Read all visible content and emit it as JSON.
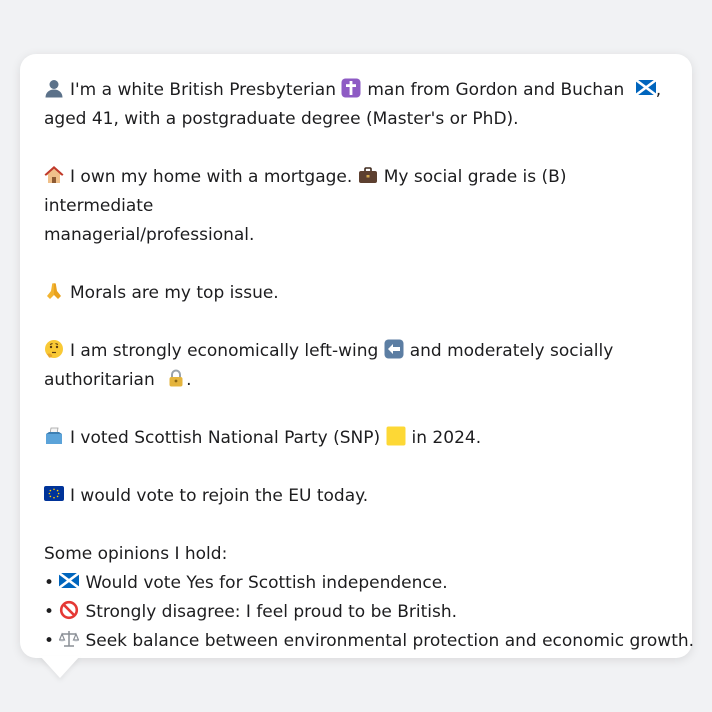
{
  "persona": {
    "intro_1": "I'm a white British Presbyterian",
    "intro_2": "man from Gordon and Buchan",
    "intro_3": ",",
    "intro_4": "aged 41, with a postgraduate degree (Master's or PhD).",
    "home_1": "I own my home with a mortgage.",
    "home_2": "My social grade is (B) intermediate",
    "home_3": "managerial/professional.",
    "issue": "Morals are my top issue.",
    "politics_1": "I am strongly economically left-wing",
    "politics_2": "and moderately socially",
    "politics_3": "authoritarian",
    "politics_4": ".",
    "vote_1": "I voted Scottish National Party (SNP)",
    "vote_2": "in 2024.",
    "eu": "I would vote to rejoin the EU today.",
    "opinions_header": "Some opinions I hold:",
    "bullet": "•",
    "opinions": [
      "Would vote Yes for Scottish independence.",
      "Strongly disagree: I feel proud to be British.",
      "Seek balance between environmental protection and economic growth."
    ]
  },
  "icons": {
    "person": "person-silhouette-icon",
    "cross": "latin-cross-icon",
    "scotland_flag": "scotland-flag-icon",
    "house": "house-icon",
    "briefcase": "briefcase-icon",
    "pray": "folded-hands-icon",
    "thinking": "thinking-face-icon",
    "left_arrow": "left-arrow-icon",
    "lock": "lock-icon",
    "ballot": "ballot-box-icon",
    "snp_square": "yellow-square-icon",
    "eu_flag": "eu-flag-icon",
    "prohibited": "prohibited-icon",
    "scales": "balance-scale-icon"
  },
  "colors": {
    "background": "#f1f2f4",
    "bubble": "#ffffff",
    "text": "#1d1d1f",
    "snp_yellow": "#fdd835",
    "saltire_blue": "#0065bd",
    "eu_blue": "#003399",
    "prohibited_red": "#e53935"
  }
}
